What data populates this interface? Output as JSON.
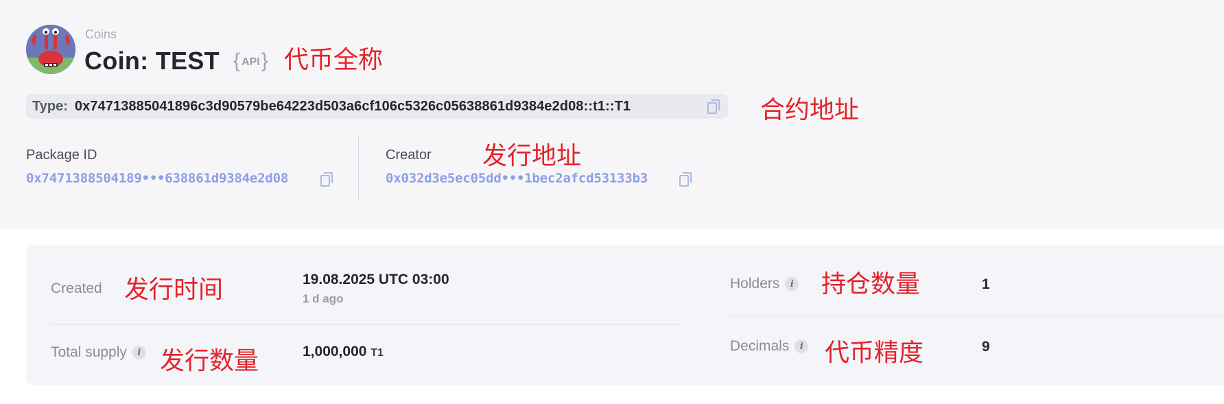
{
  "header": {
    "breadcrumb": "Coins",
    "title": "Coin: TEST",
    "api_badge": {
      "open": "{",
      "text": "API",
      "close": "}"
    },
    "avatar_icon": "crab-character-avatar"
  },
  "type_bar": {
    "label": "Type:",
    "value": "0x74713885041896c3d90579be64223d503a6cf106c5326c05638861d9384e2d08::t1::T1",
    "copy_icon": "copy-icon"
  },
  "package": {
    "label": "Package ID",
    "value": "0x7471388504189•••638861d9384e2d08"
  },
  "creator": {
    "label": "Creator",
    "value": "0x032d3e5ec05dd•••1bec2afcd53133b3"
  },
  "stats": {
    "created_label": "Created",
    "created_value": "19.08.2025 UTC 03:00",
    "created_ago": "1 d ago",
    "supply_label": "Total supply",
    "supply_value": "1,000,000",
    "supply_unit": "T1",
    "holders_label": "Holders",
    "holders_value": "1",
    "decimals_label": "Decimals",
    "decimals_value": "9",
    "info_glyph": "i"
  },
  "annotations": {
    "full_name": "代币全称",
    "contract_address": "合约地址",
    "issuer_address": "发行地址",
    "issue_time": "发行时间",
    "issue_amount": "发行数量",
    "holders_count": "持仓数量",
    "precision": "代币精度"
  },
  "colors": {
    "annotation": "#e4232a",
    "link": "#8aa0e6",
    "header_bg": "#f6f6f9",
    "card_bg": "#f4f5f9"
  }
}
